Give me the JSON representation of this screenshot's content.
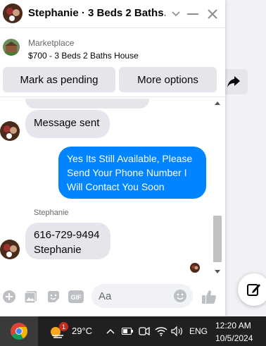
{
  "chat": {
    "title": "Stephanie · 3 Beds 2 Baths…",
    "listing": {
      "category": "Marketplace",
      "item": "$700 - 3 Beds 2 Baths House"
    },
    "actions": {
      "pending_label": "Mark as pending",
      "more_label": "More options"
    },
    "messages": [
      {
        "direction": "in",
        "text": "Message sent"
      },
      {
        "direction": "out",
        "text": "Yes Its Still Available, Please Send Your Phone Number I Will Contact You Soon"
      },
      {
        "direction": "in",
        "sender": "Stephanie",
        "text_line1": "616-729-9494",
        "text_line2": "Stephanie"
      }
    ],
    "composer": {
      "placeholder": "Aa",
      "icons": [
        "plus-circle-icon",
        "photo-icon",
        "sticker-icon",
        "gif-icon",
        "emoji-icon",
        "thumbs-up-icon"
      ]
    }
  },
  "taskbar": {
    "weather": "29°C",
    "weather_badge": "1",
    "language": "ENG",
    "time": "12:20 AM",
    "date": "10/5/2024"
  },
  "colors": {
    "accent": "#0084ff",
    "bubble_in": "#e4e6eb",
    "taskbar": "#202020"
  }
}
